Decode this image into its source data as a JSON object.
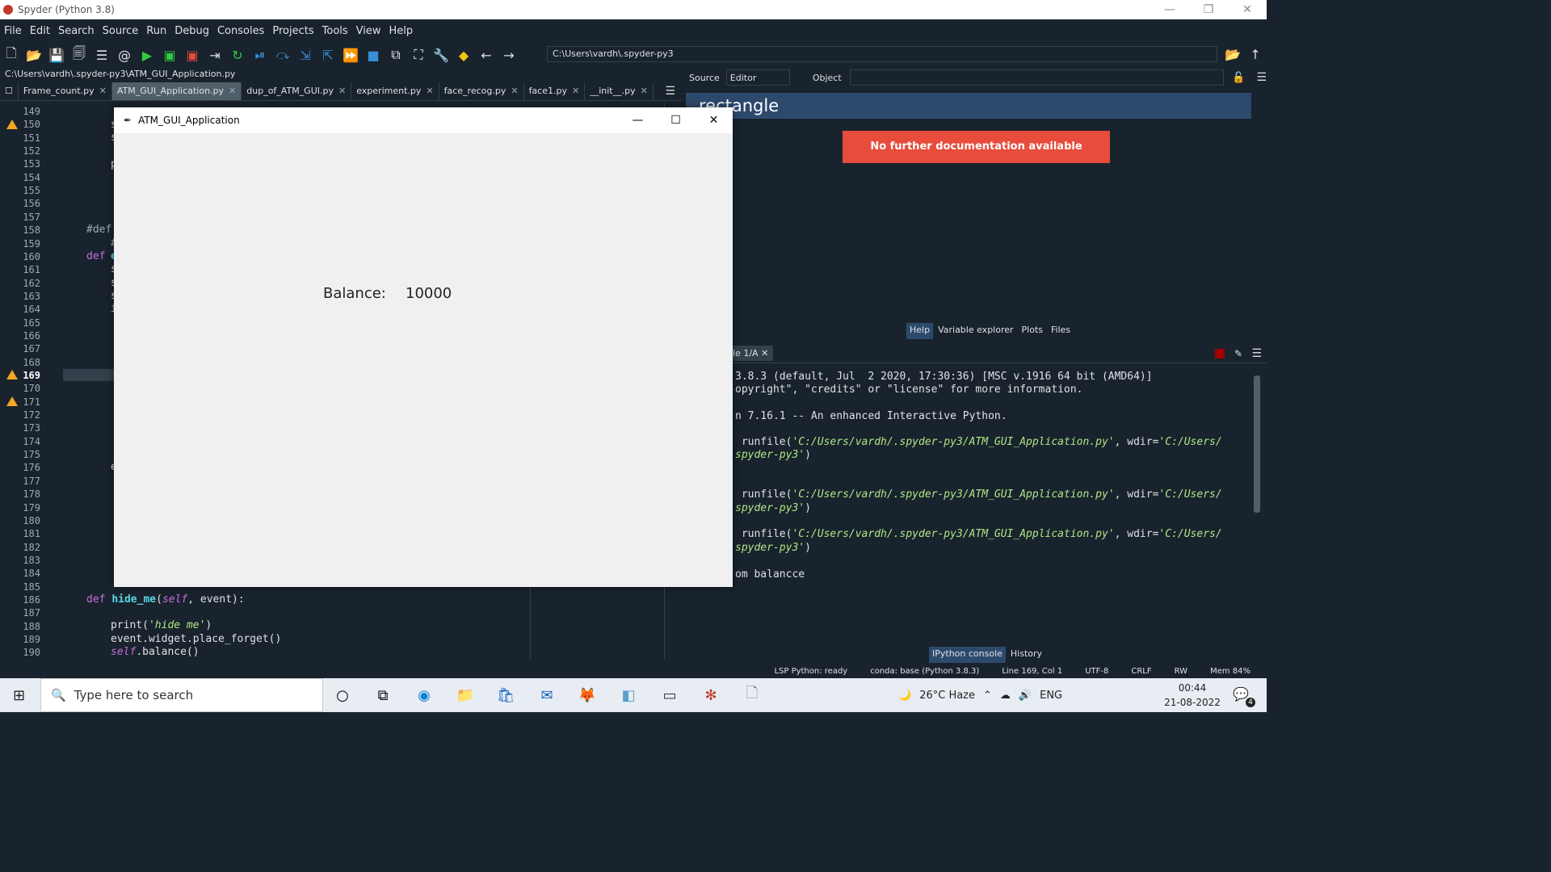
{
  "window": {
    "title": "Spyder (Python 3.8)",
    "controls": [
      "—",
      "❐",
      "✕"
    ]
  },
  "menubar": [
    "File",
    "Edit",
    "Search",
    "Source",
    "Run",
    "Debug",
    "Consoles",
    "Projects",
    "Tools",
    "View",
    "Help"
  ],
  "toolbar": {
    "path": "C:\\Users\\vardh\\.spyder-py3"
  },
  "editor": {
    "filepath": "C:\\Users\\vardh\\.spyder-py3\\ATM_GUI_Application.py",
    "tabs": [
      "Frame_count.py",
      "ATM_GUI_Application.py",
      "dup_of_ATM_GUI.py",
      "experiment.py",
      "face_recog.py",
      "face1.py",
      "__init__.py"
    ],
    "active_tab": "ATM_GUI_Application.py",
    "line_numbers": [
      "149",
      "150",
      "151",
      "152",
      "153",
      "154",
      "155",
      "156",
      "157",
      "158",
      "159",
      "160",
      "161",
      "162",
      "163",
      "164",
      "165",
      "166",
      "167",
      "168",
      "169",
      "170",
      "171",
      "172",
      "173",
      "174",
      "175",
      "176",
      "177",
      "178",
      "179",
      "180",
      "181",
      "182",
      "183",
      "184",
      "185",
      "186",
      "187",
      "188",
      "189",
      "190"
    ],
    "current_line": "169",
    "code": {
      "l150": "s",
      "l151": "s",
      "l153": "p",
      "l158": "#def",
      "l159": "#",
      "l160_kw": "def",
      "l160_fn": "e",
      "l161": "s",
      "l162": "s",
      "l163": "s",
      "l164": "i",
      "l176": "e",
      "l186_kw": "def",
      "l186_fn": "hide_me",
      "l186_a": "(",
      "l186_self": "self",
      "l186_b": ", event):",
      "l188_a": "print(",
      "l188_str": "'hide me'",
      "l188_b": ")",
      "l189": "event.widget.place_forget()",
      "l190_self": "self",
      "l190_b": ".balance()"
    }
  },
  "help": {
    "source_label": "Source",
    "source_value": "Editor",
    "object_label": "Object",
    "title": "rectangle",
    "no_doc": "No further documentation available",
    "tabs": [
      "Help",
      "Variable explorer",
      "Plots",
      "Files"
    ]
  },
  "console": {
    "tab": "le 1/A",
    "lines": [
      "3.8.3 (default, Jul  2 2020, 17:30:36) [MSC v.1916 64 bit (AMD64)]",
      "opyright\", \"credits\" or \"license\" for more information.",
      "",
      "n 7.16.1 -- An enhanced Interactive Python.",
      ""
    ],
    "runfile_a": " runfile(",
    "runfile_path": "'C:/Users/vardh/.spyder-py3/ATM_GUI_Application.py'",
    "runfile_b": ", wdir=",
    "runfile_wdir": "'C:/Users/",
    "runfile_wdir2": "spyder-py3'",
    "runfile_c": ")",
    "last": "om balancce",
    "tabs": [
      "IPython console",
      "History"
    ]
  },
  "status": {
    "lsp": "LSP Python: ready",
    "conda": "conda: base (Python 3.8.3)",
    "position": "Line 169, Col 1",
    "encoding": "UTF-8",
    "eol": "CRLF",
    "mode": "RW",
    "mem": "Mem 84%"
  },
  "app": {
    "title": "ATM_GUI_Application",
    "balance_label": "Balance:",
    "balance_value": "10000"
  },
  "taskbar": {
    "search_placeholder": "Type here to search",
    "weather": "26°C  Haze",
    "lang": "ENG",
    "time": "00:44",
    "date": "21-08-2022",
    "notifications": "4"
  }
}
